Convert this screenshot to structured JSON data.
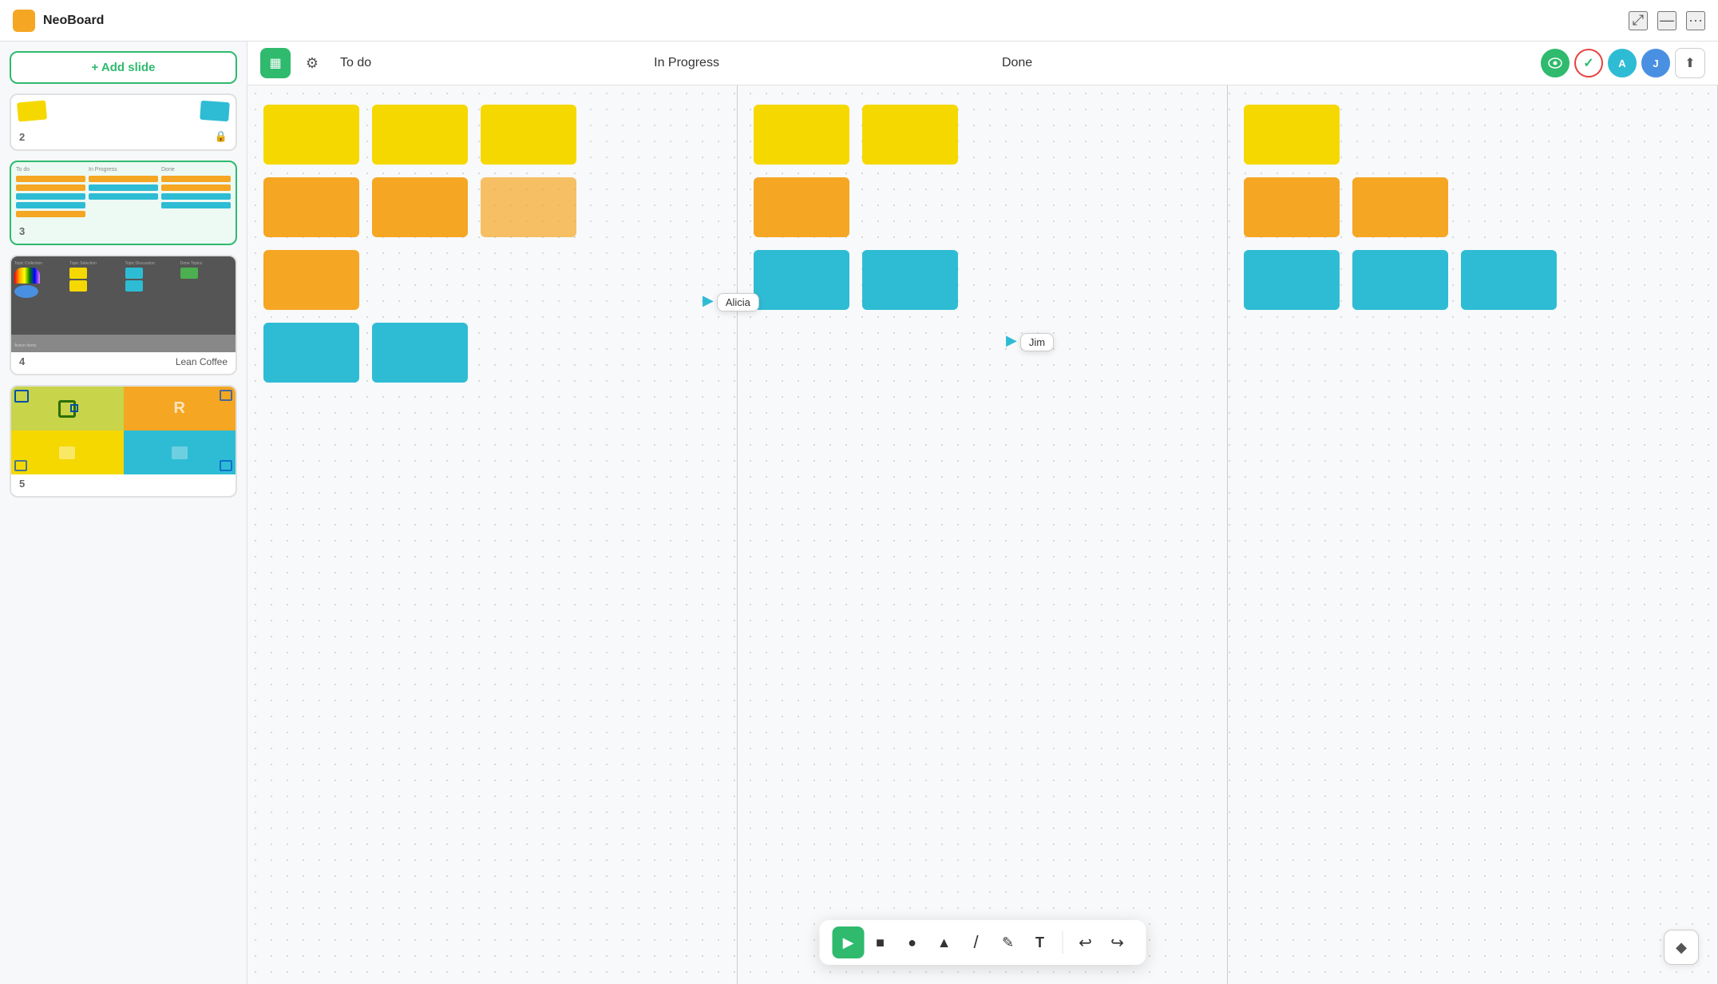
{
  "app": {
    "title": "NeoBoard",
    "logo_color": "#f5a623"
  },
  "topbar": {
    "maximize_label": "⤢",
    "minimize_label": "—",
    "menu_label": "···"
  },
  "sidebar": {
    "add_slide_label": "+ Add slide",
    "slides": [
      {
        "id": 2,
        "type": "sticky",
        "locked": true
      },
      {
        "id": 3,
        "type": "kanban",
        "active": true
      },
      {
        "id": 4,
        "type": "lean-coffee",
        "label": "Lean Coffee"
      },
      {
        "id": 5,
        "type": "quadrant"
      }
    ]
  },
  "canvas": {
    "columns": [
      {
        "id": "todo",
        "label": "To do"
      },
      {
        "id": "in-progress",
        "label": "In Progress"
      },
      {
        "id": "done",
        "label": "Done"
      }
    ],
    "cursors": [
      {
        "id": "alicia",
        "name": "Alicia",
        "col": "todo",
        "color": "#2ebcd4"
      },
      {
        "id": "jim",
        "name": "Jim",
        "col": "done",
        "color": "#2ebcd4"
      }
    ],
    "avatars": [
      {
        "id": "eye",
        "type": "eye",
        "label": "👁",
        "bg": "#2fba6e",
        "border": "#2fba6e",
        "color": "#fff"
      },
      {
        "id": "check",
        "type": "check",
        "label": "✓",
        "bg": "#fff",
        "border": "#e84040",
        "color": "#2fba6e"
      },
      {
        "id": "a",
        "label": "A",
        "bg": "#2ebcd4",
        "border": "#2ebcd4",
        "color": "#fff"
      },
      {
        "id": "j",
        "label": "J",
        "bg": "#4a90e2",
        "border": "#4a90e2",
        "color": "#fff"
      }
    ],
    "tools": {
      "kanban_icon": "▦",
      "gear_icon": "⚙"
    }
  },
  "toolbar_bottom": {
    "tools": [
      {
        "id": "select",
        "icon": "▶",
        "active": true,
        "label": "Select"
      },
      {
        "id": "rect",
        "icon": "■",
        "active": false,
        "label": "Rectangle"
      },
      {
        "id": "circle",
        "icon": "●",
        "active": false,
        "label": "Circle"
      },
      {
        "id": "triangle",
        "icon": "▲",
        "active": false,
        "label": "Triangle"
      },
      {
        "id": "line",
        "icon": "/",
        "active": false,
        "label": "Line"
      },
      {
        "id": "pen",
        "icon": "✎",
        "active": false,
        "label": "Pen"
      },
      {
        "id": "text",
        "icon": "T",
        "active": false,
        "label": "Text"
      }
    ],
    "undo_label": "↩",
    "redo_label": "↪"
  },
  "help": {
    "icon": "◆"
  }
}
